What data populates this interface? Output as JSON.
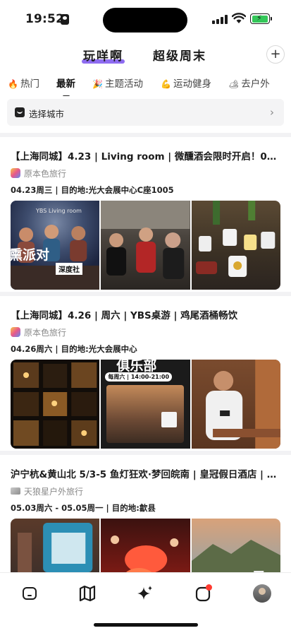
{
  "status_bar": {
    "time": "19:52"
  },
  "header": {
    "tabs": [
      {
        "label": "玩咩啊",
        "active": true
      },
      {
        "label": "超级周末",
        "active": false
      }
    ],
    "add_label": "+"
  },
  "categories": [
    {
      "label": "热门",
      "icon": "fire-icon",
      "glyph": "🔥",
      "active": false
    },
    {
      "label": "最新",
      "icon": "",
      "glyph": "",
      "active": true
    },
    {
      "label": "主题活动",
      "icon": "party-popper-icon",
      "glyph": "🎉",
      "active": false
    },
    {
      "label": "运动健身",
      "icon": "flexed-biceps-icon",
      "glyph": "💪",
      "active": false
    },
    {
      "label": "去户外",
      "icon": "outdoor-icon",
      "glyph": "🏕",
      "active": false
    }
  ],
  "city_selector": {
    "label": "选择城市"
  },
  "cards": [
    {
      "title": "【上海同城】4.23 | Living room | 微醺酒会限时开启！0压力…",
      "organizer": "原本色旅行",
      "meta": "04.23周三 | 目的地:光大会展中心C座1005",
      "photo_text": [
        "YBS Living room",
        "熏派对",
        "深度社"
      ]
    },
    {
      "title": "【上海同城】4.26 | 周六 | YBS桌游 | 鸡尾酒桶畅饮",
      "organizer": "原本色旅行",
      "meta": "04.26周六 | 目的地:光大会展中心",
      "photo_text": [
        "俱乐部",
        "每周六 | 14:00-21:00"
      ]
    },
    {
      "title": "沪宁杭&黄山北 5/3-5 鱼灯狂欢·梦回皖南 | 皇冠假日酒店 | 瞻…",
      "organizer": "天狼星户外旅行",
      "meta": "05.03周六 - 05.05周一 | 目的地:歙县",
      "photo_text": []
    }
  ],
  "bottom_nav": [
    {
      "name": "home-icon"
    },
    {
      "name": "map-icon"
    },
    {
      "name": "sparkle-icon"
    },
    {
      "name": "messages-icon",
      "badge": true
    },
    {
      "name": "avatar"
    }
  ]
}
